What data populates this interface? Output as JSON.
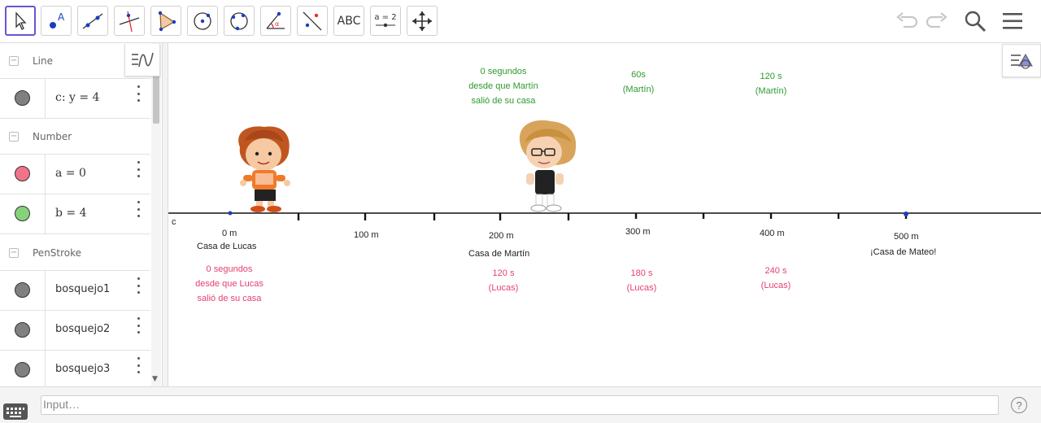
{
  "toolbar": {
    "text_tool_label": "ABC",
    "slider_tool_label": "a = 2",
    "icons": [
      "move-icon",
      "point-icon",
      "line-icon",
      "perpendicular-line-icon",
      "polygon-icon",
      "circle-center-point-icon",
      "circle-three-points-icon",
      "angle-icon",
      "reflect-icon",
      "text-icon",
      "slider-icon",
      "move-graphics-icon"
    ]
  },
  "algebra": {
    "groups": [
      {
        "label": "Line"
      },
      {
        "label": "Number"
      },
      {
        "label": "PenStroke"
      }
    ],
    "items": [
      {
        "expr": "c: y = 4",
        "color": "#808080"
      },
      {
        "expr": "a = 0",
        "color": "#f0738a"
      },
      {
        "expr": "b = 4",
        "color": "#86d27a"
      },
      {
        "expr": "bosquejo1",
        "color": "#808080"
      },
      {
        "expr": "bosquejo2",
        "color": "#808080"
      },
      {
        "expr": "bosquejo3",
        "color": "#808080"
      }
    ]
  },
  "graphics": {
    "line_label": "c",
    "distances": [
      "0 m",
      "100 m",
      "200 m",
      "300 m",
      "400 m",
      "500 m"
    ],
    "places": {
      "lucas": "Casa de Lucas",
      "martin": "Casa de Martín",
      "mateo": "¡Casa de Mateo!"
    },
    "lucas_times": {
      "t0": [
        "0 segundos",
        "desde que Lucas",
        "salió de su casa"
      ],
      "t120": [
        "120 s",
        "(Lucas)"
      ],
      "t180": [
        "180 s",
        "(Lucas)"
      ],
      "t240": [
        "240 s",
        "(Lucas)"
      ]
    },
    "martin_times": {
      "t0": [
        "0 segundos",
        "desde que Martín",
        "salió de su casa"
      ],
      "t60": [
        "60s",
        "(Martín)"
      ],
      "t120": [
        "120 s",
        "(Martín)"
      ]
    }
  },
  "input": {
    "placeholder": "Input…",
    "help": "?"
  },
  "colors": {
    "selected_tool": "#6557d2",
    "pink": "#e6406f",
    "green": "#2e9a2e"
  }
}
